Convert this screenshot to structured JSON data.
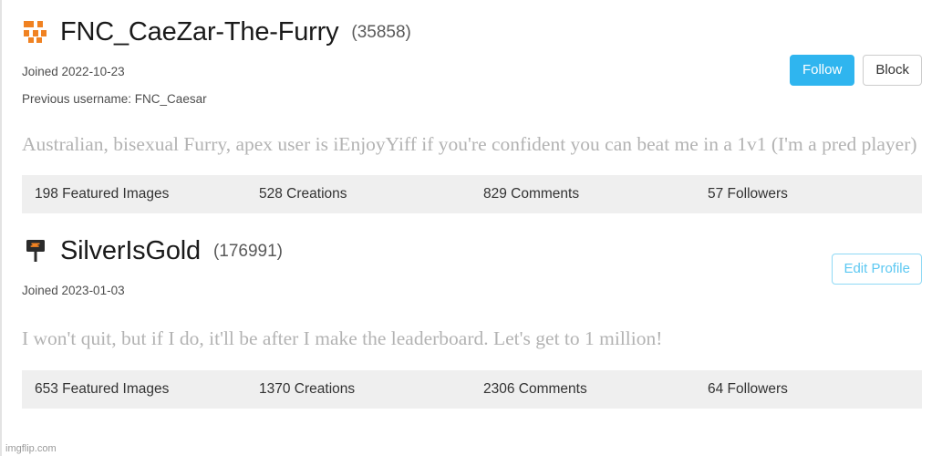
{
  "profiles": [
    {
      "avatar_icon": "orange-pixel-blocks-icon",
      "username": "FNC_CaeZar-The-Furry",
      "user_id": "(35858)",
      "joined": "Joined 2022-10-23",
      "previous_username": "Previous username: FNC_Caesar",
      "bio": "Australian, bisexual Furry, apex user is iEnjoyYiff if you're confident you can beat me in a 1v1 (I'm a pred player)",
      "actions": [
        {
          "label": "Follow",
          "style": "primary"
        },
        {
          "label": "Block",
          "style": "secondary"
        }
      ],
      "stats": [
        "198 Featured Images",
        "528 Creations",
        "829 Comments",
        "57 Followers"
      ]
    },
    {
      "avatar_icon": "dark-signpost-icon",
      "username": "SilverIsGold",
      "user_id": "(176991)",
      "joined": "Joined 2023-01-03",
      "previous_username": "",
      "bio": "I won't quit, but if I do, it'll be after I make the leaderboard. Let's get to 1 million!",
      "actions": [
        {
          "label": "Edit Profile",
          "style": "outline"
        }
      ],
      "stats": [
        "653 Featured Images",
        "1370 Creations",
        "2306 Comments",
        "64 Followers"
      ]
    }
  ],
  "watermark": "imgflip.com",
  "colors": {
    "accent_blue": "#2fb5ef",
    "outline_blue": "#8fd9f5",
    "avatar_orange": "#f08222",
    "stats_bg": "#efefef",
    "bio_text": "#b3b3b3"
  }
}
